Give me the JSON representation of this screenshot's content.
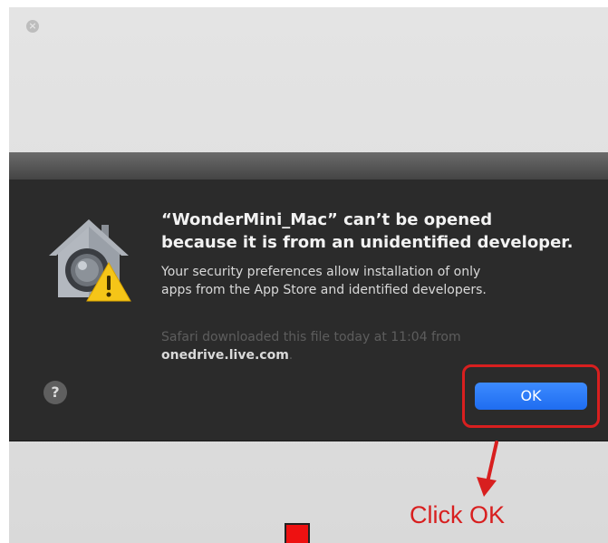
{
  "window": {
    "close_glyph": "×"
  },
  "dialog": {
    "title_line1": "“WonderMini_Mac” can’t be opened",
    "title_line2": "because it is from an unidentified developer.",
    "message_line1": "Your security preferences allow installation of only",
    "message_line2": "apps from the App Store and identified developers.",
    "info_line1": "Safari downloaded this file today at 11:04 from",
    "info_source": "onedrive.live.com",
    "info_period": ".",
    "help_label": "?",
    "ok_label": "OK",
    "icon": "gatekeeper-house-warning-icon"
  },
  "annotation": {
    "label": "Click OK",
    "color": "#d81f1f"
  },
  "colors": {
    "dialog_background": "#2b2b2b",
    "ok_button": "#2a7bf7",
    "warning": "#f5c518"
  }
}
